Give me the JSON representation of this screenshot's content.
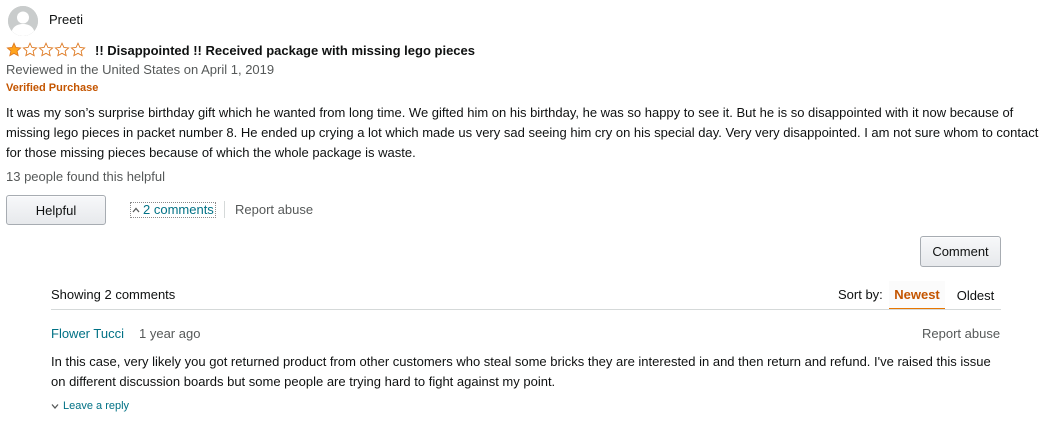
{
  "review": {
    "username": "Preeti",
    "rating": 1,
    "max_rating": 5,
    "title": "!! Disappointed !! Received package with missing lego pieces",
    "reviewed_line": "Reviewed in the United States on April 1, 2019",
    "verified": "Verified Purchase",
    "body": "It was my son’s surprise birthday gift which he wanted from long time. We gifted him on his birthday, he was so happy to see it. But he is so disappointed with it now because of missing lego pieces in packet number 8. He ended up crying a lot which made us very sad seeing him cry on his special day. Very very disappointed. I am not sure whom to contact for those missing pieces because of which the whole package is waste.",
    "helpful_count": "13 people found this helpful",
    "helpful_button": "Helpful",
    "comments_toggle": "2 comments",
    "report_abuse": "Report abuse"
  },
  "comments_section": {
    "comment_button": "Comment",
    "showing": "Showing 2 comments",
    "sort_label": "Sort by:",
    "sort_options": [
      "Newest",
      "Oldest"
    ],
    "selected_sort": "Newest",
    "comments": [
      {
        "author": "Flower Tucci",
        "time": "1 year ago",
        "report_abuse": "Report abuse",
        "text": "In this case, very likely you got returned product from other customers who steal some bricks they are interested in and then return and refund. I've raised this issue on different discussion boards but some people are trying hard to fight against my point.",
        "reply_label": "Leave a reply"
      }
    ]
  },
  "colors": {
    "link": "#007185",
    "accent": "#c45500",
    "star_fill": "#ffa41c",
    "star_outline": "#de7921",
    "muted": "#565959"
  },
  "icons": {
    "avatar": "user-avatar-icon",
    "star_filled": "star-filled-icon",
    "star_empty": "star-empty-icon",
    "toggle": "chevron-up-icon",
    "reply": "chevron-down-icon"
  }
}
